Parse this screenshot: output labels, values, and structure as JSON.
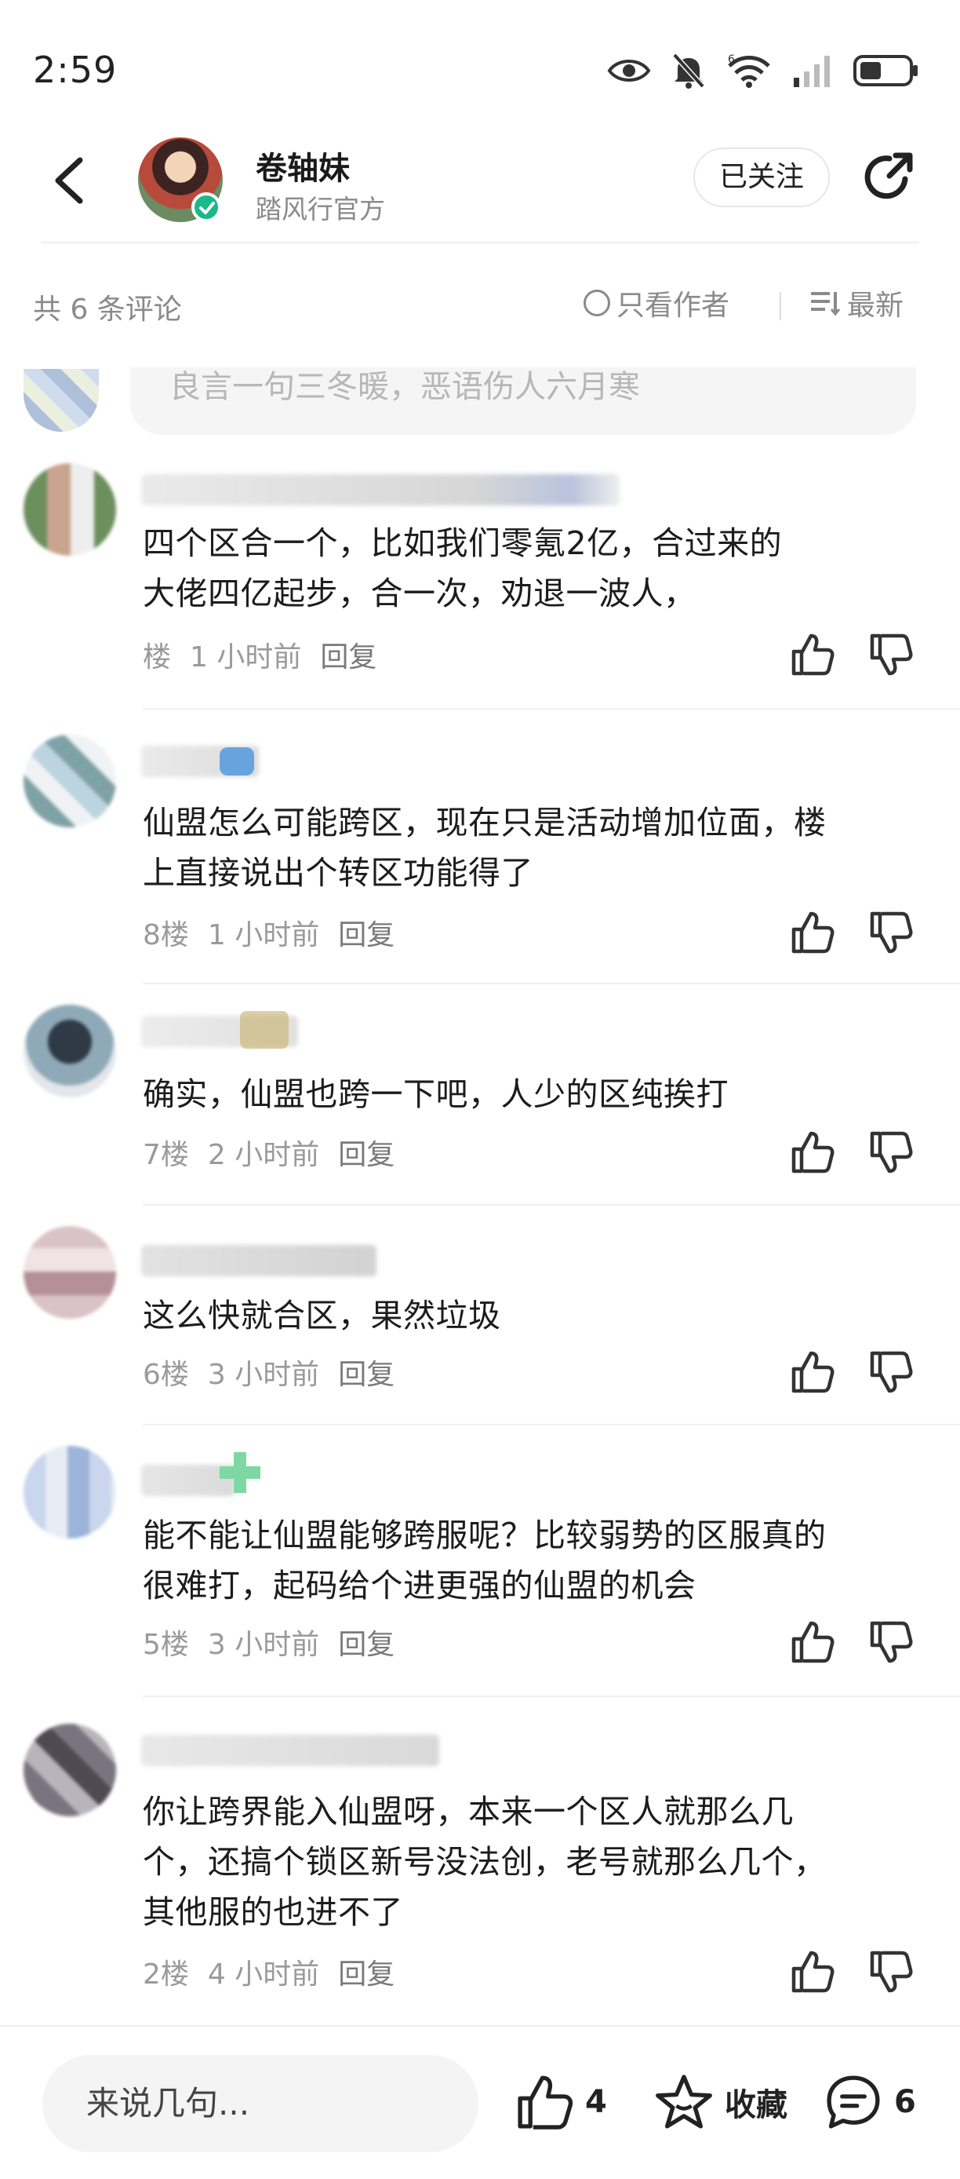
{
  "status_bar": {
    "time": "2:59",
    "icons": [
      "eye-icon",
      "bell-muted-icon",
      "wifi-6-icon",
      "signal-icon",
      "battery-icon"
    ],
    "wifi_badge": "6"
  },
  "header": {
    "author_name": "卷轴妹",
    "author_subtitle": "踏风行官方",
    "follow_label": "已关注",
    "icons": [
      "back-icon",
      "verified-icon",
      "share-icon"
    ]
  },
  "filter_bar": {
    "count_label": "共 6 条评论",
    "author_only_label": "只看作者",
    "sort_label": "最新"
  },
  "reply_placeholder": "良言一句三冬暖，恶语伤人六月寒",
  "comments": [
    {
      "text_lines": [
        "四个区合一个，比如我们零氪2亿，合过来的",
        "大佬四亿起步，合一次，劝退一波人，"
      ],
      "floor": "楼",
      "time": "1 小时前",
      "reply": "回复"
    },
    {
      "text_lines": [
        "仙盟怎么可能跨区，现在只是活动增加位面，楼",
        "上直接说出个转区功能得了"
      ],
      "floor": "8楼",
      "time": "1 小时前",
      "reply": "回复"
    },
    {
      "text_lines": [
        "确实，仙盟也跨一下吧，人少的区纯挨打"
      ],
      "floor": "7楼",
      "time": "2 小时前",
      "reply": "回复"
    },
    {
      "text_lines": [
        "这么快就合区，果然垃圾"
      ],
      "floor": "6楼",
      "time": "3 小时前",
      "reply": "回复"
    },
    {
      "text_lines": [
        "能不能让仙盟能够跨服呢？比较弱势的区服真的",
        "很难打，起码给个进更强的仙盟的机会"
      ],
      "floor": "5楼",
      "time": "3 小时前",
      "reply": "回复"
    },
    {
      "text_lines": [
        "你让跨界能入仙盟呀，本来一个区人就那么几",
        "个，还搞个锁区新号没法创，老号就那么几个，",
        "其他服的也进不了"
      ],
      "floor": "2楼",
      "time": "4 小时前",
      "reply": "回复"
    }
  ],
  "bottom_bar": {
    "input_placeholder": "来说几句...",
    "like_count": "4",
    "favorite_label": "收藏",
    "comment_count": "6"
  }
}
